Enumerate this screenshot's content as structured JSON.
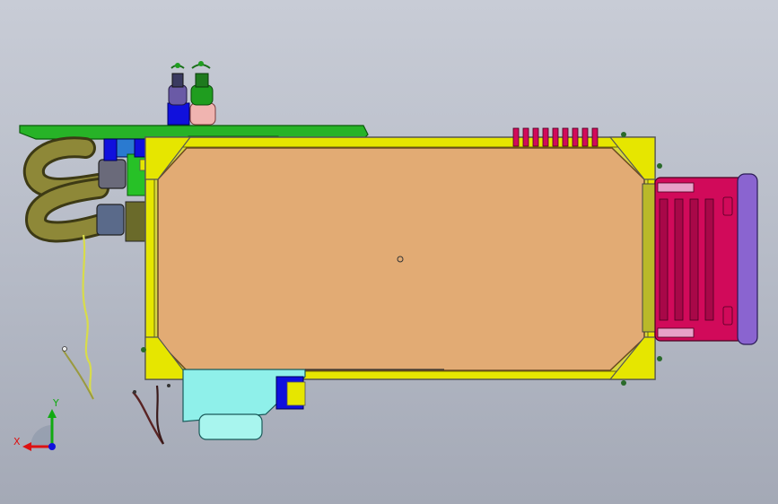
{
  "viewport": {
    "background_top": "#c8ccd6",
    "background_bottom": "#a4a9b6"
  },
  "model": {
    "panel_color": "#e2ab74",
    "frame_color": "#e6e600",
    "top_plate_color": "#27b327",
    "heatsink_color": "#d10a5a",
    "end_cap_color": "#8a64d0",
    "hose_color": "#6f6a2a",
    "bottom_bracket_color": "#8ff0ea",
    "connector_blue": "#1010dd",
    "connector_green": "#1f9d1f"
  },
  "triad": {
    "x_label": "X",
    "y_label": "Y",
    "x_color": "#dd1111",
    "y_color": "#11aa11",
    "z_color": "#1111dd"
  }
}
